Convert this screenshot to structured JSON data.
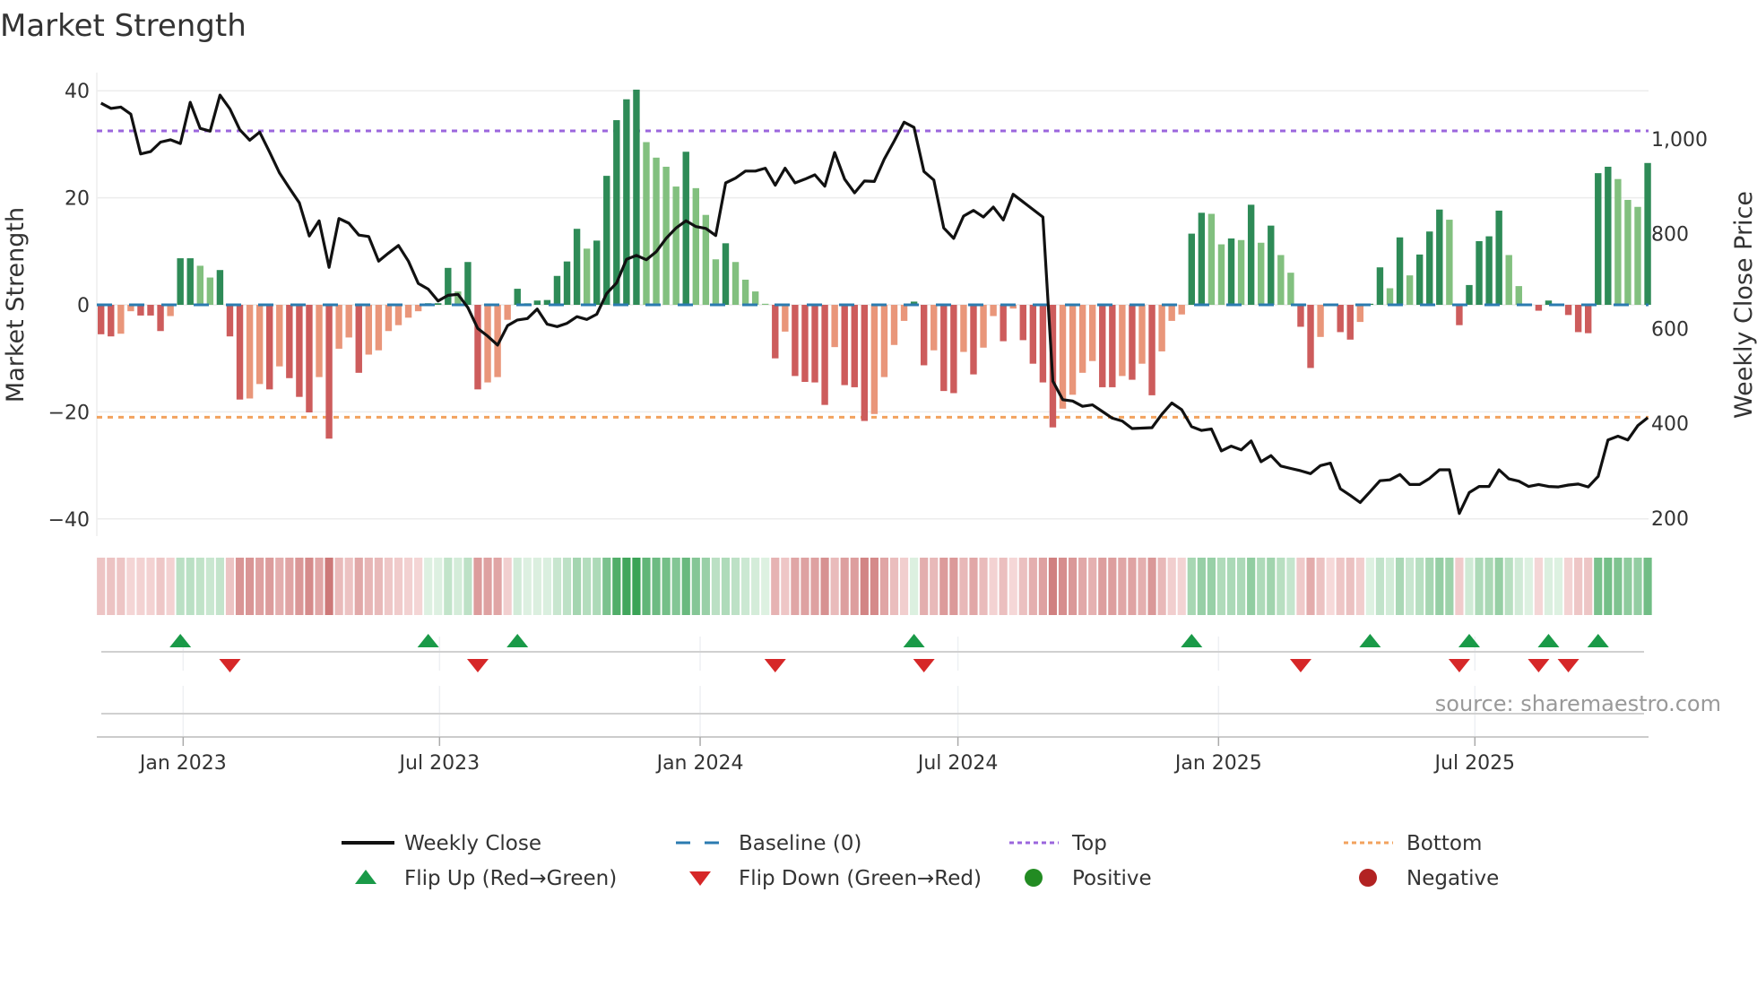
{
  "chart_data": {
    "type": "bar",
    "title": "Market Strength",
    "ylabel": "Market Strength",
    "y2label": "Weekly Close Price",
    "ylim": [
      -40,
      40
    ],
    "y2lim": [
      198,
      1102
    ],
    "y_ticks": [
      40,
      20,
      0,
      -20,
      -40
    ],
    "y2_ticks": [
      {
        "value": 1000,
        "label": "1,000"
      },
      {
        "value": 800,
        "label": "800"
      },
      {
        "value": 600,
        "label": "600"
      },
      {
        "value": 400,
        "label": "400"
      },
      {
        "value": 200,
        "label": "200"
      }
    ],
    "x_start": "2022-11-04",
    "x_step_days": 7,
    "x_ticks": [
      {
        "label": "Jan 2023",
        "date": "2023-01-01"
      },
      {
        "label": "Jul 2023",
        "date": "2023-07-01"
      },
      {
        "label": "Jan 2024",
        "date": "2024-01-01"
      },
      {
        "label": "Jul 2024",
        "date": "2024-07-01"
      },
      {
        "label": "Jan 2025",
        "date": "2025-01-01"
      },
      {
        "label": "Jul 2025",
        "date": "2025-07-01"
      }
    ],
    "top_level": 32.5,
    "bottom_level": -21,
    "strength": [
      -5.5,
      -5.9,
      -5.4,
      -1.2,
      -2,
      -2,
      -4.9,
      -2.1,
      8.7,
      8.7,
      7.3,
      5.1,
      6.5,
      -5.9,
      -17.7,
      -17.5,
      -14.8,
      -15.8,
      -11.5,
      -13.7,
      -17.2,
      -20.1,
      -13.5,
      -25,
      -8.2,
      -6.1,
      -12.7,
      -9.3,
      -8.5,
      -4.9,
      -3.8,
      -2.4,
      -1.2,
      0.3,
      0.3,
      6.9,
      2.5,
      8,
      -15.8,
      -14.5,
      -13.5,
      -2.8,
      3,
      0.3,
      0.8,
      0.9,
      5.4,
      8.1,
      14.2,
      10.5,
      12,
      24.1,
      34.5,
      38.4,
      40.2,
      30.4,
      27.5,
      25.8,
      22.1,
      28.6,
      21.8,
      16.8,
      8.5,
      11.5,
      8,
      4.7,
      2.5,
      0.2,
      -10,
      -5,
      -13.3,
      -14.4,
      -14.5,
      -18.7,
      -7.9,
      -15,
      -15.4,
      -21.7,
      -20.4,
      -13.5,
      -7.5,
      -3,
      0.6,
      -11.3,
      -8.5,
      -16.1,
      -16.5,
      -8.8,
      -13,
      -8,
      -2.1,
      -6.8,
      -0.7,
      -6.6,
      -11,
      -14.5,
      -22.9,
      -19.4,
      -16.8,
      -12.7,
      -10.5,
      -15.4,
      -15.4,
      -13.3,
      -14,
      -11,
      -16.9,
      -8.7,
      -3,
      -1.8,
      13.3,
      17.2,
      17,
      11.3,
      12.4,
      12.1,
      18.7,
      11.6,
      14.8,
      9.3,
      6,
      -4.1,
      -11.8,
      -6,
      -0.2,
      -5.1,
      -6.5,
      -3.2,
      0.2,
      7,
      3.1,
      12.6,
      5.5,
      9.4,
      13.7,
      17.8,
      15.9,
      -3.8,
      3.7,
      11.9,
      12.8,
      17.6,
      9.3,
      3.5,
      0.2,
      -1.1,
      0.8,
      0.2,
      -1.9,
      -5.1,
      -5.3,
      24.6,
      25.8,
      23.5,
      19.6,
      18.3,
      26.5
    ],
    "weekly_close": [
      1075,
      1064,
      1067,
      1052,
      968,
      973,
      993,
      998,
      990,
      1077,
      1022,
      1016,
      1092,
      1063,
      1019,
      997,
      1014,
      972,
      928,
      896,
      865,
      795,
      827,
      729,
      832,
      822,
      797,
      794,
      742,
      759,
      775,
      742,
      695,
      683,
      658,
      670,
      672,
      644,
      600,
      584,
      565,
      606,
      618,
      621,
      641,
      609,
      604,
      611,
      625,
      619,
      630,
      674,
      696,
      746,
      754,
      745,
      762,
      790,
      812,
      827,
      815,
      811,
      796,
      907,
      917,
      932,
      932,
      938,
      902,
      938,
      907,
      915,
      924,
      900,
      971,
      915,
      886,
      911,
      910,
      957,
      995,
      1035,
      1024,
      931,
      913,
      812,
      790,
      837,
      849,
      835,
      856,
      829,
      883,
      867,
      851,
      835,
      489,
      450,
      447,
      436,
      439,
      425,
      411,
      405,
      389,
      390,
      391,
      419,
      443,
      429,
      393,
      385,
      388,
      342,
      352,
      344,
      363,
      319,
      332,
      310,
      305,
      300,
      294,
      311,
      316,
      262,
      248,
      233,
      256,
      279,
      281,
      292,
      271,
      271,
      284,
      302,
      302,
      210,
      254,
      267,
      267,
      302,
      283,
      278,
      267,
      271,
      267,
      266,
      270,
      272,
      266,
      288,
      365,
      373,
      365,
      395,
      412
    ],
    "flip_up_weeks": [
      9,
      34,
      43,
      83,
      111,
      129,
      139,
      147,
      152
    ],
    "flip_down_weeks": [
      14,
      39,
      69,
      84,
      122,
      138,
      146,
      149
    ],
    "legend": {
      "placement": "bottom",
      "items": [
        {
          "key": "close",
          "label": "Weekly Close"
        },
        {
          "key": "baseline",
          "label": "Baseline (0)"
        },
        {
          "key": "top",
          "label": "Top"
        },
        {
          "key": "bottom",
          "label": "Bottom"
        },
        {
          "key": "flip_up",
          "label": "Flip Up (Red→Green)"
        },
        {
          "key": "flip_down",
          "label": "Flip Down (Green→Red)"
        },
        {
          "key": "positive",
          "label": "Positive"
        },
        {
          "key": "negative",
          "label": "Negative"
        }
      ]
    },
    "source": "source: sharemaestro.com"
  },
  "colors": {
    "pos_strong": "#2e8b57",
    "pos_weak": "#82c07f",
    "neg_strong": "#cd5c5c",
    "neg_weak": "#e9967a",
    "baseline": "#2b7bb0",
    "top": "#9b66dd",
    "bottom": "#f2a25e",
    "close": "#111111",
    "flip_up": "#1a9a48",
    "flip_down": "#d62728",
    "positive": "#228b22",
    "negative": "#b22222"
  }
}
